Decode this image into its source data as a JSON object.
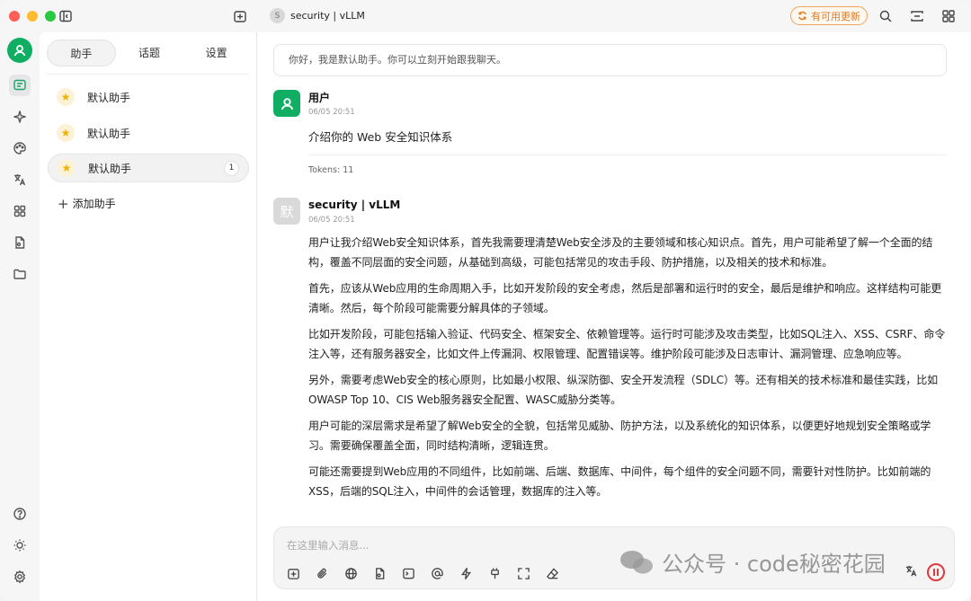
{
  "window": {
    "title": "security | vLLM",
    "title_avatar_letter": "S",
    "update_button": "有可用更新"
  },
  "sidebar": {
    "tabs": [
      "助手",
      "话题",
      "设置"
    ],
    "active_tab": "助手",
    "assistants": [
      {
        "name": "默认助手",
        "count": ""
      },
      {
        "name": "默认助手",
        "count": ""
      },
      {
        "name": "默认助手",
        "count": "1"
      }
    ],
    "add_assistant": "添加助手"
  },
  "chat": {
    "welcome": "你好，我是默认助手。你可以立刻开始跟我聊天。",
    "user_message": {
      "name": "用户",
      "time": "06/05 20:51",
      "text": "介绍你的 Web 安全知识体系",
      "tokens": "Tokens: 11"
    },
    "bot_message": {
      "avatar_letter": "默",
      "name": "security | vLLM",
      "time": "06/05 20:51",
      "paragraphs": [
        "用户让我介绍Web安全知识体系，首先我需要理清楚Web安全涉及的主要领域和核心知识点。首先，用户可能希望了解一个全面的结构，覆盖不同层面的安全问题，从基础到高级，可能包括常见的攻击手段、防护措施，以及相关的技术和标准。",
        "首先，应该从Web应用的生命周期入手，比如开发阶段的安全考虑，然后是部署和运行时的安全，最后是维护和响应。这样结构可能更清晰。然后，每个阶段可能需要分解具体的子领域。",
        "比如开发阶段，可能包括输入验证、代码安全、框架安全、依赖管理等。运行时可能涉及攻击类型，比如SQL注入、XSS、CSRF、命令注入等，还有服务器安全，比如文件上传漏洞、权限管理、配置错误等。维护阶段可能涉及日志审计、漏洞管理、应急响应等。",
        "另外，需要考虑Web安全的核心原则，比如最小权限、纵深防御、安全开发流程（SDLC）等。还有相关的技术标准和最佳实践，比如OWASP Top 10、CIS Web服务器安全配置、WASC威胁分类等。",
        "用户可能的深层需求是希望了解Web安全的全貌，包括常见威胁、防护方法，以及系统化的知识体系，以便更好地规划安全策略或学习。需要确保覆盖全面，同时结构清晰，逻辑连贯。",
        "可能还需要提到Web应用的不同组件，比如前端、后端、数据库、中间件，每个组件的安全问题不同，需要针对性防护。比如前端的XSS，后端的SQL注入，中间件的会话管理，数据库的注入等。"
      ]
    },
    "input_placeholder": "在这里输入消息..."
  },
  "watermark": "公众号 · code秘密花园"
}
